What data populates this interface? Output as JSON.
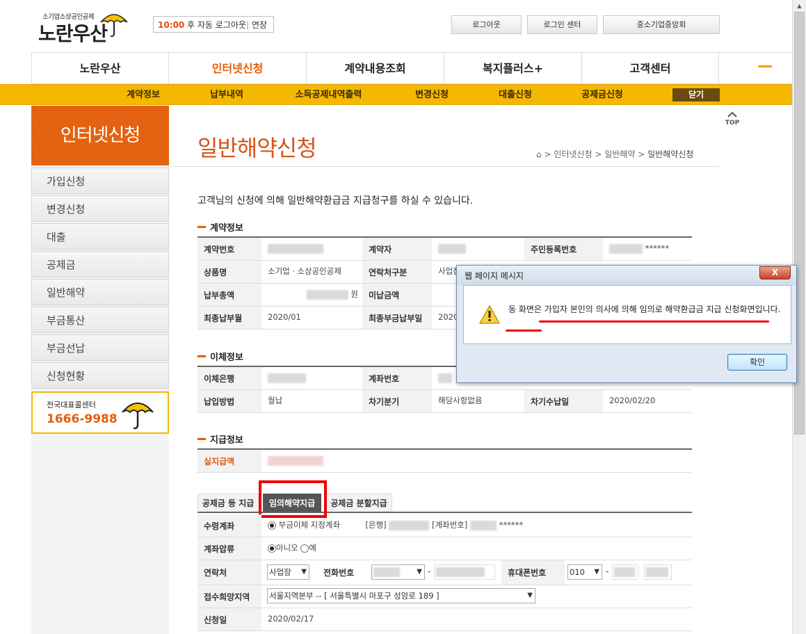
{
  "header": {
    "logo_sub": "소기업소상공인공제",
    "logo_main": "노란우산",
    "session_time": "10:00",
    "session_text": "후 자동 로그아웃",
    "session_extend": "연장",
    "logout": "로그아웃",
    "login_center": "로그인 센터",
    "kbiz": "중소기업중앙회"
  },
  "gnb": [
    "노란우산",
    "인터넷신청",
    "계약내용조회",
    "복지플러스+",
    "고객센터"
  ],
  "subnav": [
    "계약정보",
    "납부내역",
    "소득공제내역출력",
    "변경신청",
    "대출신청",
    "공제금신청"
  ],
  "subnav_close": "닫기",
  "top_label": "TOP",
  "lnb": {
    "title": "인터넷신청",
    "items": [
      "가입신청",
      "변경신청",
      "대출",
      "공제금",
      "일반해약",
      "부금통산",
      "부금선납",
      "신청현황"
    ],
    "call_label": "전국대표콜센터",
    "call_number": "1666-9988"
  },
  "page": {
    "title": "일반해약신청",
    "breadcrumb": [
      "인터넷신청",
      "일반해약",
      "일반해약신청"
    ],
    "intro": "고객님의 신청에 의해 일반해약환급금 지급청구를 하실 수 있습니다."
  },
  "contract": {
    "title": "계약정보",
    "no_label": "계약번호",
    "holder_label": "계약자",
    "rrn_label": "주민등록번호",
    "rrn_mask": "******",
    "product_label": "상품명",
    "product_value": "소기업ㆍ소상공인공제",
    "contact_type_label": "연락처구분",
    "contact_type_value": "사업장",
    "total_paid_label": "납부총액",
    "won": "원",
    "unpaid_label": "미납금액",
    "last_month_label": "최종납부월",
    "last_month_value": "2020/01",
    "last_date_label": "최종부금납부일",
    "last_date_value": "2020"
  },
  "transfer": {
    "title": "이체정보",
    "bank_label": "이체은행",
    "account_label": "계좌번호",
    "method_label": "납입방법",
    "method_value": "월납",
    "next_period_label": "차기분기",
    "next_period_value": "해당사항없음",
    "next_due_label": "차기수납일",
    "next_due_value": "2020/02/20"
  },
  "payment": {
    "title": "지급정보",
    "actual_label": "실지급액"
  },
  "tabs": [
    "공제금 등 지급",
    "임의해약지급",
    "공제금 분할지급"
  ],
  "form": {
    "receive_label": "수령계좌",
    "receive_option": "부금이체 지정계좌",
    "bank_bracket": "[은행]",
    "account_bracket": "[계좌번호]",
    "account_mask": "******",
    "seizure_label": "계좌압류",
    "seizure_no": "아니오",
    "seizure_yes": "예",
    "contact_label": "연락처",
    "contact_select": "사업장",
    "phone_label": "전화번호",
    "dash": "-",
    "mobile_label": "휴대폰번호",
    "mobile_prefix": "010",
    "region_label": "접수희망지역",
    "region_value": "서울지역본부 -- [ 서울특별시 마포구 성암로 189 ]",
    "date_label": "신청일",
    "date_value": "2020/02/17"
  },
  "dialog": {
    "title": "웹 페이지 메시지",
    "close": "X",
    "message": "동 화면은 가입자 본인의 의사에 의해 임의로 해약환급금 지급 신청화면입니다.",
    "ok": "확인"
  }
}
